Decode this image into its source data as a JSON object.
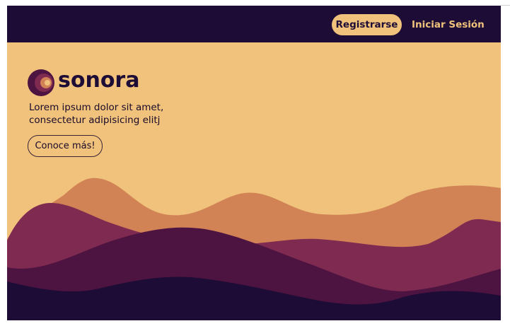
{
  "nav": {
    "register_label": "Registrarse",
    "login_label": "Iniciar Sesión"
  },
  "brand": {
    "name": "sonora",
    "logo_icon": "sun-rings-icon"
  },
  "hero": {
    "line1": "Lorem ipsum dolor sit amet,",
    "line2": "consectetur adipisicing elitj",
    "cta_label": "Conoce más!"
  },
  "colors": {
    "background": "#f0c27b",
    "navbar": "#1d0c35",
    "wave_1": "#d28356",
    "wave_2": "#7f2a50",
    "wave_3": "#4d1341",
    "wave_4": "#1d0c35"
  }
}
